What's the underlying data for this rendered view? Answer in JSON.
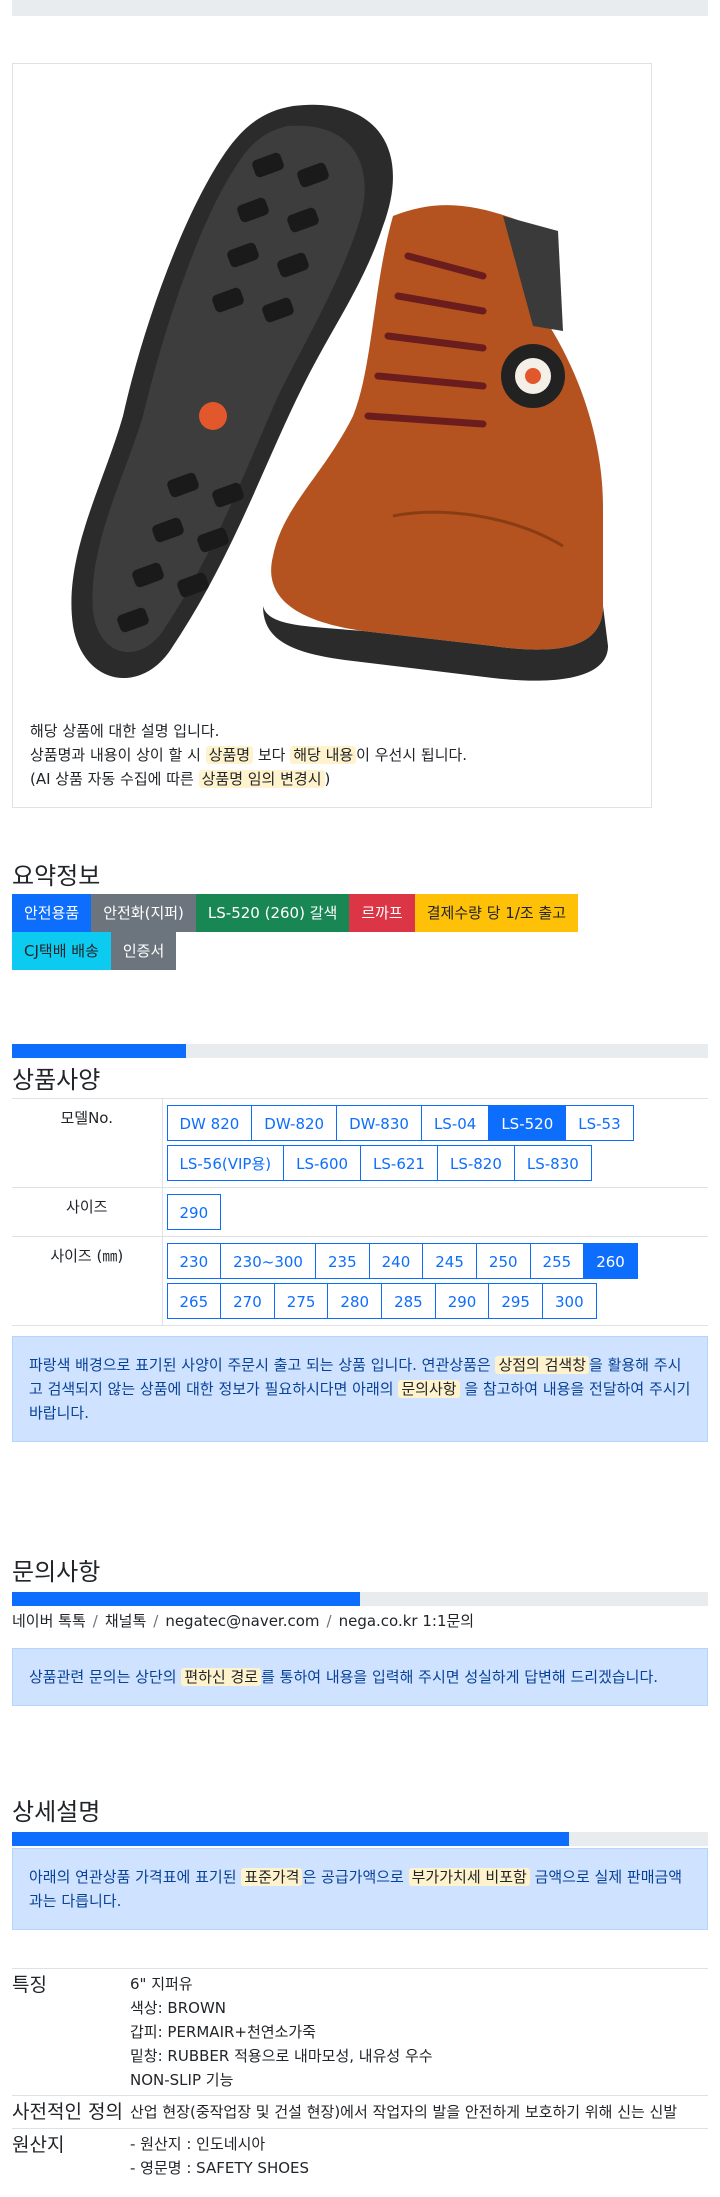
{
  "product": {
    "image_alt": "Brown leather safety boot",
    "desc_lines": {
      "l1": "해당 상품에 대한 설명 입니다.",
      "l2_a": "상품명과 내용이 상이 할 시 ",
      "l2_h1": "상품명",
      "l2_b": " 보다 ",
      "l2_h2": "해당 내용",
      "l2_c": "이 우선시 됩니다.",
      "l3_a": "(AI 상품 자동 수집에 따른 ",
      "l3_h": "상품명 임의 변경시",
      "l3_b": ")"
    }
  },
  "summary": {
    "title": "요약정보",
    "badges": [
      "안전용품",
      "안전화(지퍼)",
      "LS-520 (260) 갈색",
      "르까프",
      "결제수량 당 1/조 출고",
      "CJ택배 배송",
      "인증서"
    ]
  },
  "spec": {
    "title": "상품사양",
    "progress_percent": 25,
    "rows": [
      {
        "label": "모델No.",
        "options": [
          "DW 820",
          "DW-820",
          "DW-830",
          "LS-04",
          "LS-520",
          "LS-53",
          "LS-56(VIP용)",
          "LS-600",
          "LS-621",
          "LS-820",
          "LS-830"
        ],
        "active": "LS-520"
      },
      {
        "label": "사이즈",
        "options": [
          "290"
        ],
        "active": ""
      },
      {
        "label": "사이즈 (㎜)",
        "options": [
          "230",
          "230~300",
          "235",
          "240",
          "245",
          "250",
          "255",
          "260",
          "265",
          "270",
          "275",
          "280",
          "285",
          "290",
          "295",
          "300"
        ],
        "active": "260"
      }
    ],
    "notice": {
      "a": "파랑색 배경으로 표기된 사양이 주문시 출고 되는 상품 입니다. 연관상품은 ",
      "h1": "상점의 검색창",
      "b": "을 활용해 주시고 검색되지 않는 상품에 대한 정보가 필요하시다면 아래의 ",
      "h2": "문의사항",
      "c": " 을 참고하여 내용을 전달하여 주시기 바랍니다."
    }
  },
  "inquiry": {
    "title": "문의사항",
    "progress_percent": 50,
    "breadcrumb": [
      "네이버 톡톡",
      "채널톡",
      "negatec@naver.com",
      "nega.co.kr 1:1문의"
    ],
    "notice": {
      "a": "상품관련 문의는 상단의 ",
      "h": "편하신 경로",
      "b": "를 통하여 내용을 입력해 주시면 성실하게 답변해 드리겠습니다."
    }
  },
  "detail": {
    "title": "상세설명",
    "progress_percent": 80,
    "notice": {
      "a": "아래의 연관상품 가격표에 표기된 ",
      "h1": "표준가격",
      "b": "은 공급가액으로 ",
      "h2": "부가가치세 비포함",
      "c": " 금액으로 실제 판매금액과는 다릅니다."
    },
    "rows": [
      {
        "label": "특징",
        "lines": [
          "6\" 지퍼유",
          "색상: BROWN",
          "갑피: PERMAIR+천연소가죽",
          "밑창: RUBBER 적용으로 내마모성, 내유성 우수",
          "NON-SLIP 기능"
        ]
      },
      {
        "label": "사전적인 정의",
        "lines": [
          "산업 현장(중작업장 및 건설 현장)에서 작업자의 발을 안전하게 보호하기 위해 신는 신발"
        ]
      },
      {
        "label": "원산지",
        "lines": [
          "- 원산지 : 인도네시아",
          "- 영문명 : SAFETY SHOES"
        ]
      }
    ]
  }
}
